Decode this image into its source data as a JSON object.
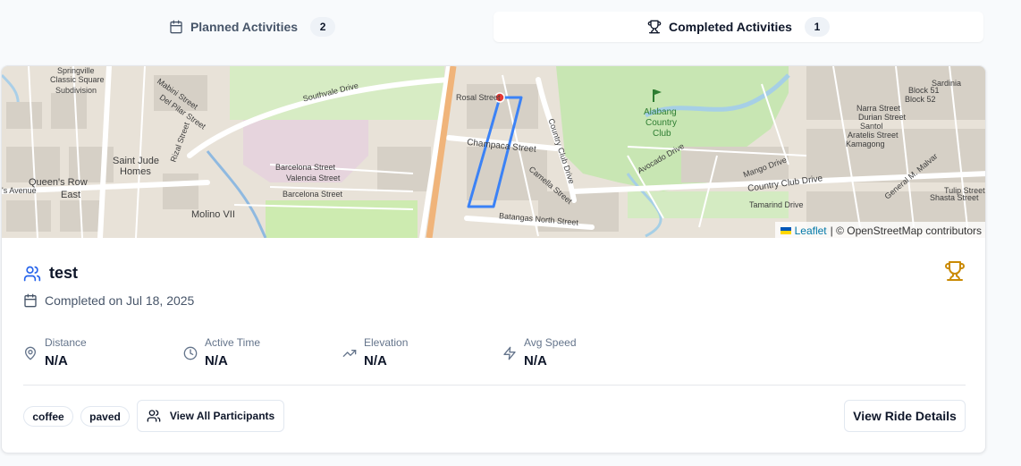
{
  "tabs": [
    {
      "label": "Planned Activities",
      "count": "2",
      "icon": "calendar-icon"
    },
    {
      "label": "Completed Activities",
      "count": "1",
      "icon": "trophy-icon"
    }
  ],
  "map": {
    "labels": {
      "springville": "Springville",
      "classic_square": "Classic Square",
      "subdivision": "Subdivision",
      "southvale": "Southvale Drive",
      "mabini": "Mabini Street",
      "del_pilar": "Del Pilar Street",
      "rizal": "Rizal Street",
      "saint_jude": "Saint Jude",
      "homes": "Homes",
      "queens_row": "Queen's Row",
      "east": "East",
      "queens_avenue": "'s Avenue",
      "molino": "Molino VII",
      "barcelona": "Barcelona Street",
      "valencia": "Valencia Street",
      "barcelona2": "Barcelona Street",
      "rosal": "Rosal Street",
      "champaca": "Champaca Street",
      "country_club": "Country Club Drive",
      "camella": "Camella Street",
      "batangas": "Batangas North Street",
      "alabang": "Alabang",
      "country": "Country",
      "club": "Club",
      "narra": "Narra Street",
      "durian": "Durian Street",
      "santol": "Santol",
      "aratelis": "Aratelis Street",
      "kamagong": "Kamagong",
      "block51": "Block 51",
      "block52": "Block 52",
      "sardinia": "Sardinia",
      "mango": "Mango Drive",
      "avocado": "Avocado Drive",
      "country_club_drive": "Country Club Drive",
      "tamarind": "Tamarind Drive",
      "tulip": "Tulip Street",
      "shasta": "Shasta Street",
      "general_malvar": "General M. Malvar"
    },
    "attribution": {
      "leaflet": "Leaflet",
      "rest": "| © OpenStreetMap contributors"
    }
  },
  "activity": {
    "title": "test",
    "date": "Completed on Jul 18, 2025",
    "stats": [
      {
        "label": "Distance",
        "value": "N/A",
        "icon": "map-pin-icon"
      },
      {
        "label": "Active Time",
        "value": "N/A",
        "icon": "clock-icon"
      },
      {
        "label": "Elevation",
        "value": "N/A",
        "icon": "trending-up-icon"
      },
      {
        "label": "Avg Speed",
        "value": "N/A",
        "icon": "zap-icon"
      }
    ],
    "tags": [
      "coffee",
      "paved"
    ],
    "participants_label": "View All Participants",
    "details_label": "View Ride Details"
  },
  "colors": {
    "accent_blue": "#2563eb",
    "trophy_gold": "#ca8a04",
    "route_blue": "#3b82f6",
    "marker_red": "#e53935"
  }
}
